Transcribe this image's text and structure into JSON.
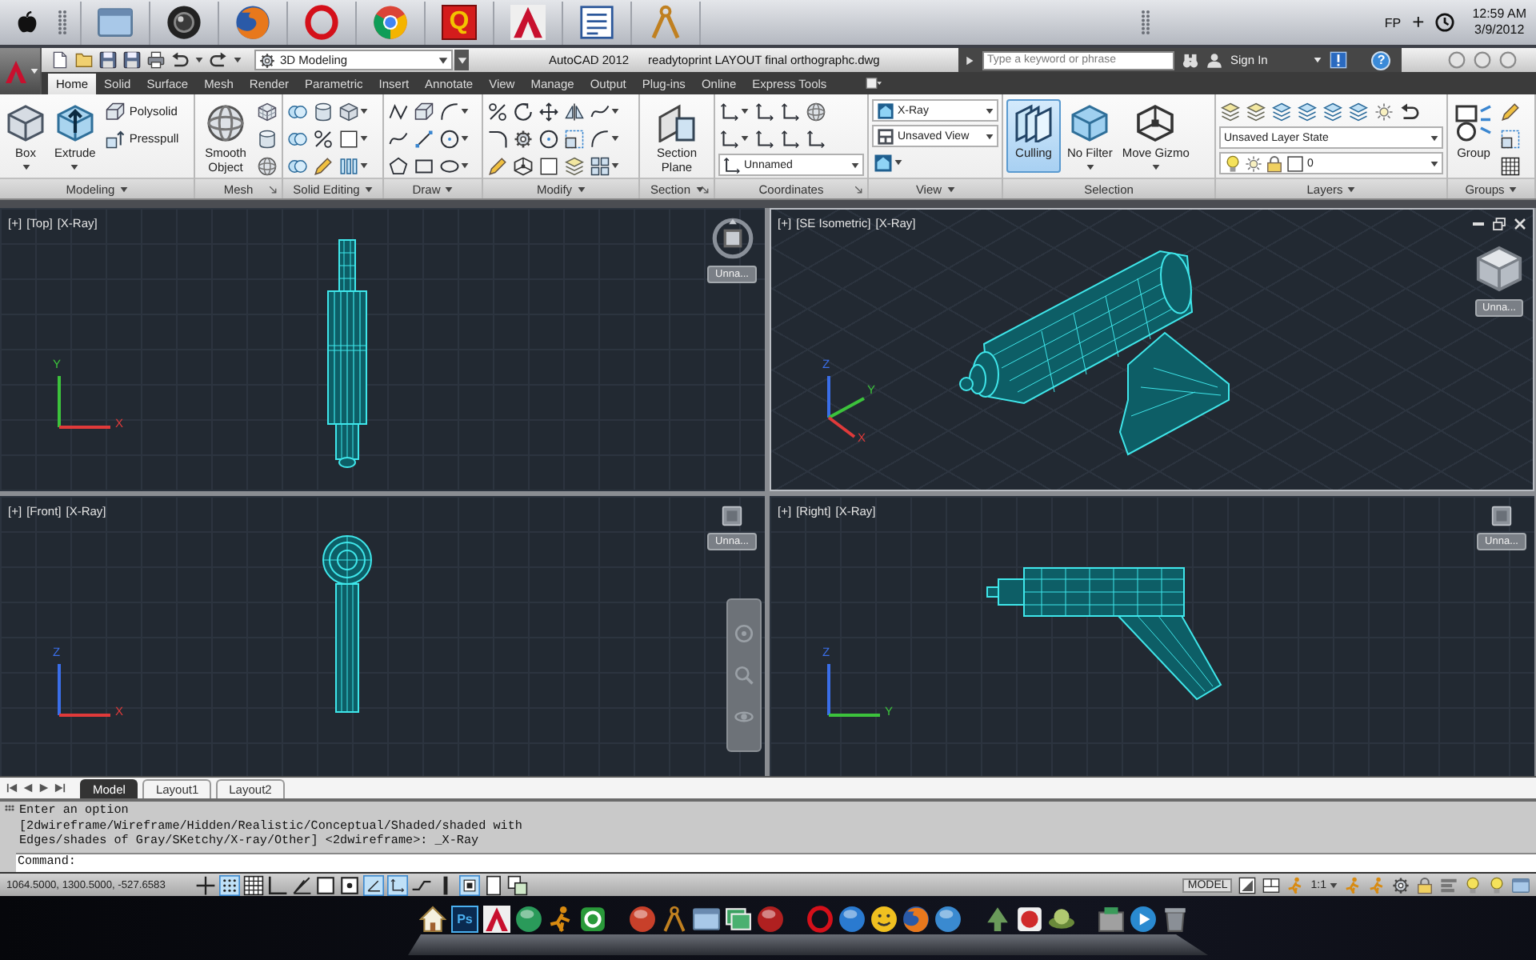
{
  "top_bar": {
    "launcher_letter": "Q",
    "indicators": [
      "FP",
      "+"
    ],
    "time": "12:59 AM",
    "date": "3/9/2012"
  },
  "title_bar": {
    "workspace": "3D Modeling",
    "app_name": "AutoCAD 2012",
    "file_name": "readytoprint LAYOUT final orthographc.dwg",
    "search": {
      "placeholder": "Type a keyword or phrase"
    },
    "sign_in": "Sign In",
    "help": "?"
  },
  "ribbon_tabs": [
    {
      "label": "Home",
      "selected": true
    },
    {
      "label": "Solid",
      "selected": false
    },
    {
      "label": "Surface",
      "selected": false
    },
    {
      "label": "Mesh",
      "selected": false
    },
    {
      "label": "Render",
      "selected": false
    },
    {
      "label": "Parametric",
      "selected": false
    },
    {
      "label": "Insert",
      "selected": false
    },
    {
      "label": "Annotate",
      "selected": false
    },
    {
      "label": "View",
      "selected": false
    },
    {
      "label": "Manage",
      "selected": false
    },
    {
      "label": "Output",
      "selected": false
    },
    {
      "label": "Plug-ins",
      "selected": false
    },
    {
      "label": "Online",
      "selected": false
    },
    {
      "label": "Express Tools",
      "selected": false
    }
  ],
  "ribbon_panels": [
    {
      "title": "Modeling",
      "menu": true,
      "launcher": false,
      "columns": [
        {
          "kind": "large",
          "label": "Box",
          "caret": true,
          "selected": false
        },
        {
          "kind": "large",
          "label": "Extrude",
          "caret": true,
          "selected": false
        },
        {
          "kind": "stack",
          "items": [
            {
              "kind": "small",
              "label": "Polysolid"
            },
            {
              "kind": "small",
              "label": "Presspull"
            }
          ]
        }
      ]
    },
    {
      "title": "Mesh",
      "menu": false,
      "launcher": true,
      "columns": [
        {
          "kind": "large",
          "label": "Smooth Object",
          "caret": false,
          "selected": false
        },
        {
          "kind": "icons"
        }
      ]
    },
    {
      "title": "Solid Editing",
      "menu": true,
      "launcher": false,
      "columns": [
        {
          "kind": "icons"
        }
      ]
    },
    {
      "title": "Draw",
      "menu": true,
      "launcher": false,
      "columns": [
        {
          "kind": "icons"
        }
      ]
    },
    {
      "title": "Modify",
      "menu": true,
      "launcher": false,
      "columns": [
        {
          "kind": "icons"
        }
      ]
    },
    {
      "title": "Section",
      "menu": true,
      "launcher": true,
      "columns": [
        {
          "kind": "large",
          "label": "Section Plane",
          "caret": false,
          "selected": false
        }
      ]
    },
    {
      "title": "Coordinates",
      "menu": false,
      "launcher": true,
      "columns": [
        {
          "kind": "stack",
          "items": [
            {
              "kind": "icon_row"
            },
            {
              "kind": "icon_row"
            },
            {
              "kind": "dropdown",
              "value": "Unnamed"
            }
          ]
        }
      ]
    },
    {
      "title": "View",
      "menu": true,
      "launcher": false,
      "columns": [
        {
          "kind": "stack",
          "items": [
            {
              "kind": "dropdown",
              "value": "X-Ray"
            },
            {
              "kind": "dropdown",
              "value": "Unsaved View"
            },
            {
              "kind": "icon_row"
            }
          ]
        }
      ]
    },
    {
      "title": "Selection",
      "menu": false,
      "launcher": false,
      "columns": [
        {
          "kind": "large",
          "label": "Culling",
          "caret": false,
          "selected": true
        },
        {
          "kind": "large",
          "label": "No Filter",
          "caret": true,
          "selected": false
        },
        {
          "kind": "large",
          "label": "Move Gizmo",
          "caret": true,
          "selected": false
        }
      ]
    },
    {
      "title": "Layers",
      "menu": true,
      "launcher": false,
      "columns": [
        {
          "kind": "stack",
          "items": [
            {
              "kind": "icon_row"
            },
            {
              "kind": "dropdown",
              "value": "Unsaved Layer State"
            },
            {
              "kind": "dropdown",
              "value": "0"
            }
          ]
        }
      ]
    },
    {
      "title": "Groups",
      "menu": true,
      "launcher": false,
      "columns": [
        {
          "kind": "large",
          "label": "Group",
          "caret": false,
          "selected": false
        },
        {
          "kind": "icons"
        }
      ]
    }
  ],
  "viewports": [
    {
      "kind": "top",
      "label_parts": [
        "[+]",
        "[Top]",
        "[X-Ray]"
      ],
      "view_name": "Unna...",
      "active": false,
      "navigation_bar": false,
      "ucs_axes": [
        {
          "label": "Y",
          "color": "#3cc23c"
        },
        {
          "label": "X",
          "color": "#e03a3a"
        }
      ]
    },
    {
      "kind": "isometric",
      "label_parts": [
        "[+]",
        "[SE Isometric]",
        "[X-Ray]"
      ],
      "view_name": "Unna...",
      "active": true,
      "navigation_bar": false,
      "ucs_axes": [
        {
          "label": "Z",
          "color": "#3a6ee8"
        },
        {
          "label": "Y",
          "color": "#3cc23c"
        },
        {
          "label": "X",
          "color": "#e03a3a"
        }
      ]
    },
    {
      "kind": "front",
      "label_parts": [
        "[+]",
        "[Front]",
        "[X-Ray]"
      ],
      "view_name": "Unna...",
      "active": false,
      "navigation_bar": true,
      "ucs_axes": [
        {
          "label": "Z",
          "color": "#3a6ee8"
        },
        {
          "label": "X",
          "color": "#e03a3a"
        }
      ]
    },
    {
      "kind": "right",
      "label_parts": [
        "[+]",
        "[Right]",
        "[X-Ray]"
      ],
      "view_name": "Unna...",
      "active": false,
      "navigation_bar": false,
      "ucs_axes": [
        {
          "label": "Z",
          "color": "#3a6ee8"
        },
        {
          "label": "Y",
          "color": "#3cc23c"
        }
      ]
    }
  ],
  "layout_tabs": [
    {
      "label": "Model",
      "selected": true
    },
    {
      "label": "Layout1",
      "selected": false
    },
    {
      "label": "Layout2",
      "selected": false
    }
  ],
  "command_line": {
    "history": [
      "Enter an option",
      "[2dwireframe/Wireframe/Hidden/Realistic/Conceptual/Shaded/shaded with",
      "Edges/shades of Gray/SKetchy/X-ray/Other] <2dwireframe>: _X-Ray"
    ],
    "prompt": "Command:"
  },
  "status_bar": {
    "coordinates": "1064.5000, 1300.5000, -527.6583",
    "drafting_toggles": [
      {
        "on": false
      },
      {
        "on": true
      },
      {
        "on": false
      },
      {
        "on": false
      },
      {
        "on": false
      },
      {
        "on": false
      },
      {
        "on": false
      },
      {
        "on": true
      },
      {
        "on": true
      },
      {
        "on": false
      },
      {
        "on": false
      },
      {
        "on": true
      },
      {
        "on": false
      },
      {
        "on": false
      }
    ],
    "space": "MODEL",
    "annotation_scale": "1:1"
  },
  "dock": {
    "tile_label": "Ps"
  }
}
